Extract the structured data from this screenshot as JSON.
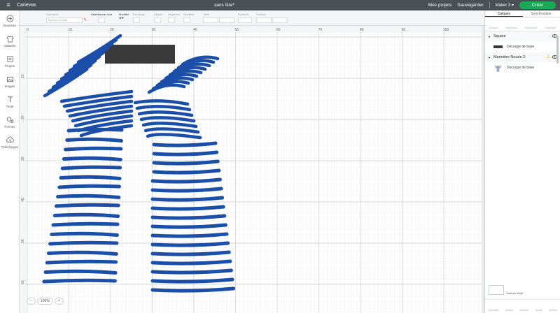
{
  "header": {
    "app_name": "Canevas",
    "doc_title": "sans titre*",
    "my_projects": "Mes projets",
    "save": "Sauvegarder",
    "machine": "Maker 3",
    "create": "Créer"
  },
  "left_tools": [
    {
      "label": "Nouveau",
      "icon": "plus-icon"
    },
    {
      "label": "Gabarits",
      "icon": "shirt-icon"
    },
    {
      "label": "Projets",
      "icon": "projects-icon"
    },
    {
      "label": "Images",
      "icon": "image-icon"
    },
    {
      "label": "Texte",
      "icon": "text-icon"
    },
    {
      "label": "Formes",
      "icon": "shapes-icon"
    },
    {
      "label": "Téléchargez",
      "icon": "upload-icon"
    }
  ],
  "editbar": {
    "operation_label": "Opération",
    "operation_value": "Découpe de base",
    "select_all": "Sélectionner tout",
    "edit": "Modifier",
    "offset": "Décalage",
    "align": "Aligner",
    "arrange": "Organiser",
    "flip": "Symétrie",
    "size": "Taille",
    "rotate": "Rotation",
    "position": "Position"
  },
  "ruler": {
    "top": [
      "0",
      "10",
      "20",
      "30",
      "40",
      "50",
      "60",
      "70",
      "80",
      "90",
      "100"
    ],
    "left": [
      "10",
      "20",
      "30",
      "40",
      "50",
      "60"
    ]
  },
  "canvas": {
    "zoom": "100%",
    "zoom_minus": "−",
    "zoom_plus": "+"
  },
  "right_panel": {
    "tabs": [
      "Calques",
      "Synchroniser"
    ],
    "layer_actions": [
      "Grouper",
      "Dégrouper",
      "Reproduire",
      "Supprimer"
    ],
    "groups": [
      {
        "name": "Square",
        "layer": "Découpe de base",
        "warning": false
      },
      {
        "name": "Marinière Nouée 2",
        "layer": "Découpe de base",
        "warning": true
      }
    ],
    "blank_canvas": "Canevas vierge",
    "bottom_actions": [
      "Découper",
      "Souder",
      "Attacher",
      "Aplatir",
      "Contour"
    ]
  },
  "colors": {
    "stripe": "#1a4ea8",
    "square": "#3a3a3a",
    "create_button": "#1aaa55",
    "header": "#4b5054"
  }
}
